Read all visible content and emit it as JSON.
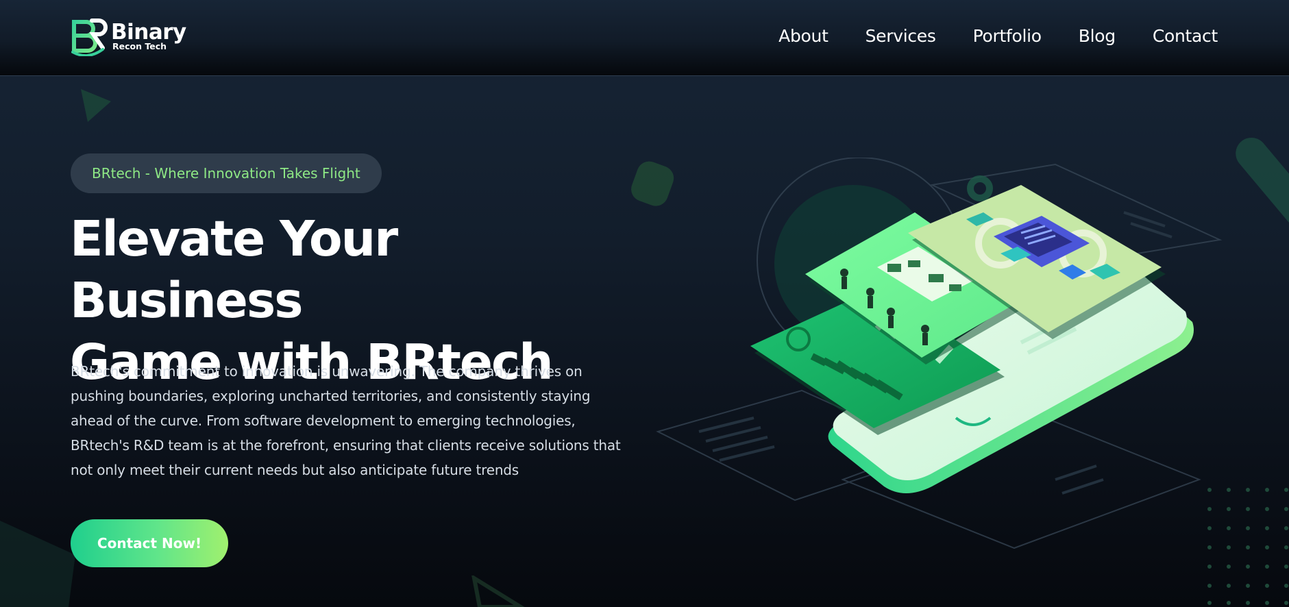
{
  "brand": {
    "name": "Binary",
    "subtitle": "Recon Tech",
    "colors": {
      "green": "#4ade80",
      "teal": "#1fcf8d",
      "accent_text": "#8ee885",
      "background": "#121d2b"
    }
  },
  "nav": {
    "items": [
      {
        "label": "About"
      },
      {
        "label": "Services"
      },
      {
        "label": "Portfolio"
      },
      {
        "label": "Blog"
      },
      {
        "label": "Contact"
      }
    ]
  },
  "hero": {
    "tagline": "BRtech - Where Innovation Takes Flight",
    "title_line1": "Elevate Your Business",
    "title_line2": "Game with BRtech",
    "description": "BRtech's commitment to innovation is unwavering. The company thrives on pushing boundaries, exploring uncharted territories, and consistently staying ahead of the curve. From software development to emerging technologies, BRtech's R&D team is at the forefront, ensuring that clients receive solutions that not only meet their current needs but also anticipate future trends",
    "cta_label": "Contact Now!"
  },
  "icons": {
    "logo": "br-logo-icon",
    "illustration": "isometric-phone-dashboard-illustration"
  }
}
